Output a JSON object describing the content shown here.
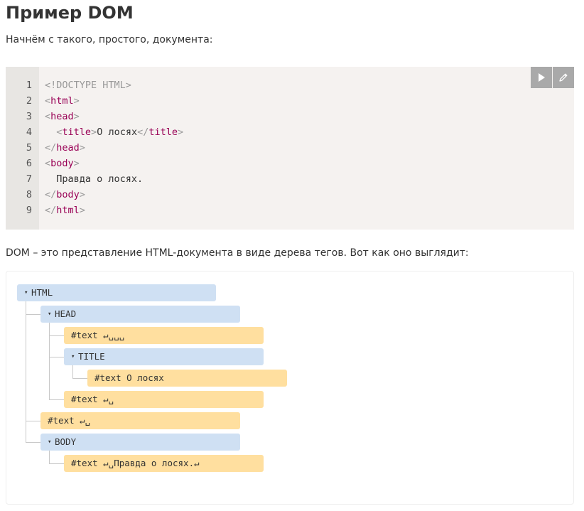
{
  "title": "Пример DOM",
  "intro": "Начнём с такого, простого, документа:",
  "code": {
    "line_numbers": [
      "1",
      "2",
      "3",
      "4",
      "5",
      "6",
      "7",
      "8",
      "9"
    ],
    "lines": [
      "<!DOCTYPE HTML>",
      "<html>",
      "<head>",
      "  <title>О лосях</title>",
      "</head>",
      "<body>",
      "  Правда о лосях.",
      "</body>",
      "</html>"
    ],
    "buttons": {
      "run_icon": "play-icon",
      "edit_icon": "pencil-icon"
    },
    "colors": {
      "tag": "#990055",
      "punct": "#999999",
      "text": "#333333",
      "background": "#f5f2f0",
      "gutter": "#e8e6e3"
    }
  },
  "dom_text": "DOM – это представление HTML-документа в виде дерева тегов. Вот как оно выглядит:",
  "tree": {
    "nodes": [
      {
        "kind": "element",
        "label": "HTML"
      },
      {
        "kind": "element",
        "label": "HEAD"
      },
      {
        "kind": "text",
        "label": "#text ↵␣␣␣"
      },
      {
        "kind": "element",
        "label": "TITLE"
      },
      {
        "kind": "text",
        "label": "#text О лосях"
      },
      {
        "kind": "text",
        "label": "#text ↵␣"
      },
      {
        "kind": "text",
        "label": "#text ↵␣"
      },
      {
        "kind": "element",
        "label": "BODY"
      },
      {
        "kind": "text",
        "label": "#text ↵␣Правда о лосях.↵"
      }
    ],
    "expand_glyph": "▾",
    "colors": {
      "element": "#cfe0f3",
      "text": "#ffdf9f",
      "connector": "#c8c8c8"
    }
  }
}
